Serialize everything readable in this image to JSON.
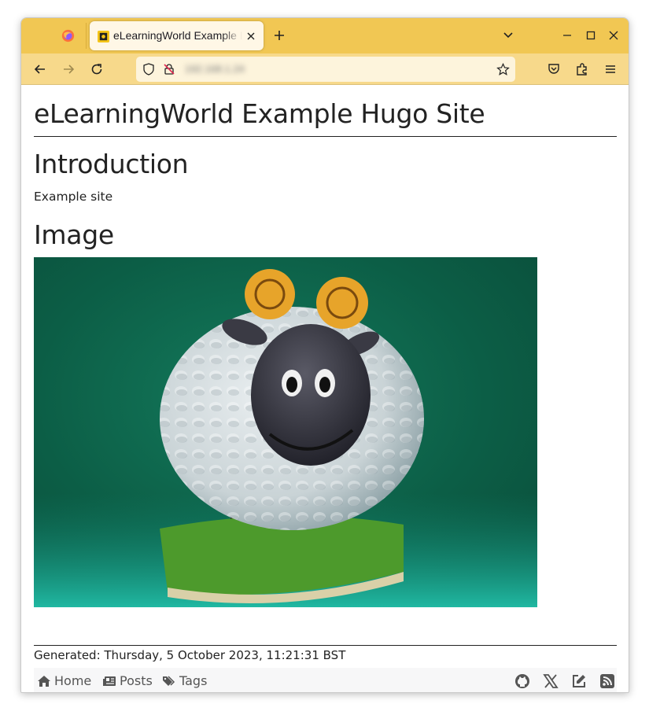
{
  "browser": {
    "tab_title": "eLearningWorld Example Hugo Site",
    "url": "192.168.1.24"
  },
  "page": {
    "site_title": "eLearningWorld Example Hugo Site",
    "intro_heading": "Introduction",
    "intro_text": "Example site",
    "image_heading": "Image",
    "generated": "Generated: Thursday, 5 October 2023, 11:21:31 BST"
  },
  "footer_nav": {
    "items": [
      {
        "label": "Home",
        "icon": "home-icon"
      },
      {
        "label": "Posts",
        "icon": "newspaper-icon"
      },
      {
        "label": "Tags",
        "icon": "tags-icon"
      }
    ],
    "social_icons": [
      "github-icon",
      "x-icon",
      "edit-icon",
      "rss-icon"
    ]
  },
  "colors": {
    "tabbar": "#f1c753",
    "navbar": "#f7d98b",
    "photo_background": "#0f6a52"
  }
}
